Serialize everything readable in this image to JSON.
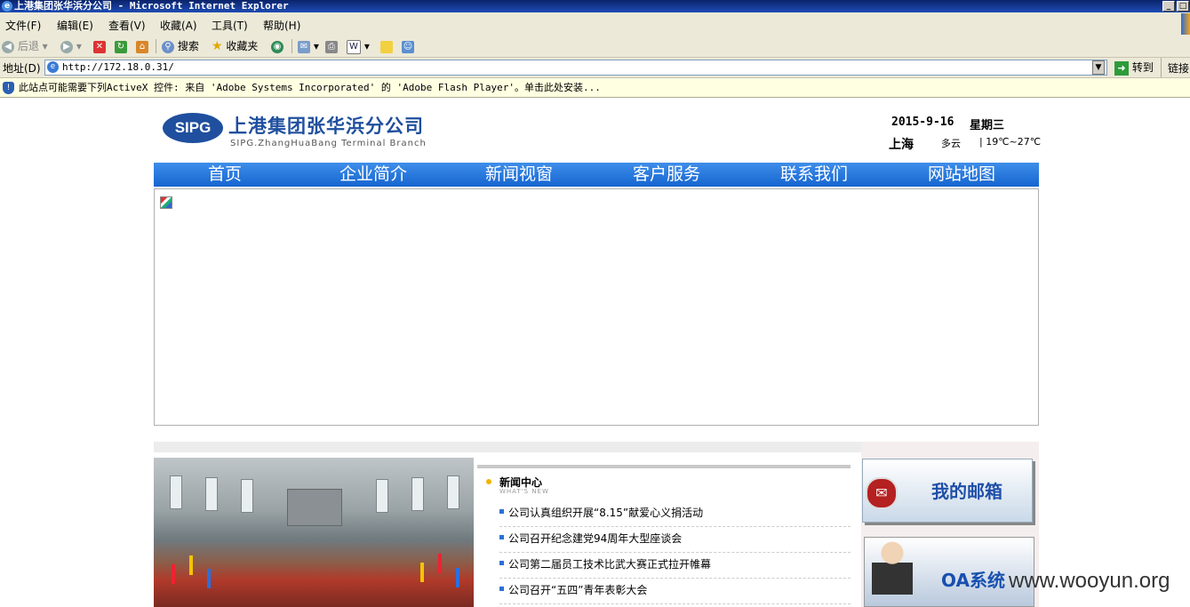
{
  "window": {
    "title": "上港集团张华浜分公司 - Microsoft Internet Explorer",
    "controls": {
      "minimize": "_",
      "maximize": "□"
    }
  },
  "menu": [
    "文件(F)",
    "编辑(E)",
    "查看(V)",
    "收藏(A)",
    "工具(T)",
    "帮助(H)"
  ],
  "toolbar": {
    "back": "后退",
    "search": "搜索",
    "favorites": "收藏夹"
  },
  "address": {
    "label": "地址(D)",
    "url": "http://172.18.0.31/",
    "go": "转到",
    "links": "链接"
  },
  "infobar": {
    "text": "此站点可能需要下列ActiveX 控件: 来自 'Adobe Systems Incorporated' 的 'Adobe Flash Player'。单击此处安装..."
  },
  "site": {
    "logo_abbr": "SIPG",
    "logo_cn": "上港集团张华浜分公司",
    "logo_en": "SIPG.ZhangHuaBang Terminal Branch",
    "date": "2015-9-16",
    "weekday": "星期三",
    "city": "上海",
    "weather": "多云",
    "temp": "| 19℃~27℃",
    "nav": [
      "首页",
      "企业简介",
      "新闻视窗",
      "客户服务",
      "联系我们",
      "网站地图"
    ],
    "news": {
      "title": "新闻中心",
      "subtitle": "WHAT'S NEW",
      "items": [
        "公司认真组织开展“8.15”献爱心义捐活动",
        "公司召开纪念建党94周年大型座谈会",
        "公司第二届员工技术比武大赛正式拉开帷幕",
        "公司召开“五四”青年表彰大会"
      ]
    },
    "mailbox": "我的邮箱",
    "oa": "OA系统"
  },
  "watermark": "www.wooyun.org"
}
